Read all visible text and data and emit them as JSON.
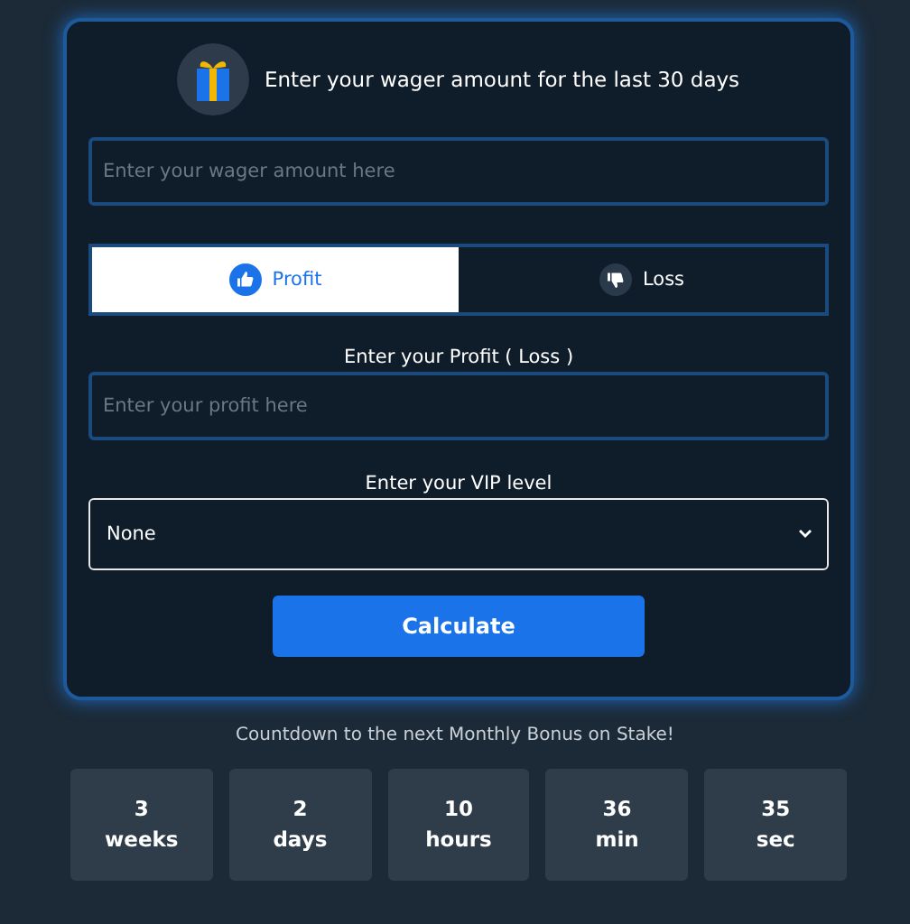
{
  "card": {
    "title": "Enter your wager amount for the last 30 days",
    "wager_field": {
      "placeholder": "Enter your wager amount here"
    },
    "toggle": [
      {
        "label": "Profit",
        "kind": "up",
        "selected": true
      },
      {
        "label": "Loss",
        "kind": "down",
        "selected": false
      }
    ],
    "profit_label": "Enter your Profit ( Loss )",
    "profit_field": {
      "placeholder": "Enter your profit here"
    },
    "vip_label": "Enter your VIP level",
    "vip_select": {
      "value": "None"
    },
    "button": "Calculate"
  },
  "countdown": {
    "title": "Countdown to the next Monthly Bonus on Stake!",
    "units": [
      {
        "value": "3",
        "unit": "weeks"
      },
      {
        "value": "2",
        "unit": "days"
      },
      {
        "value": "10",
        "unit": "hours"
      },
      {
        "value": "36",
        "unit": "min"
      },
      {
        "value": "35",
        "unit": "sec"
      }
    ]
  }
}
